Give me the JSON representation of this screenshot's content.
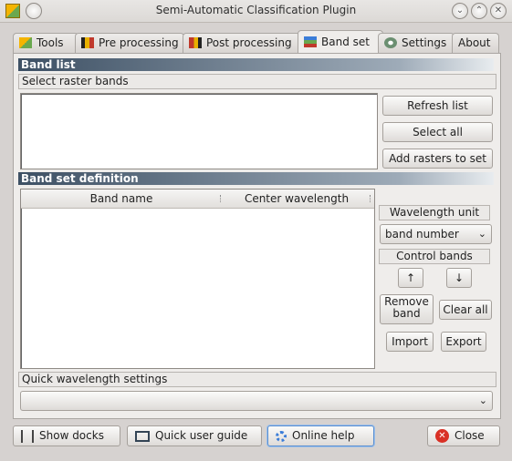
{
  "window": {
    "title": "Semi-Automatic Classification Plugin"
  },
  "tabs": [
    {
      "label": "Tools",
      "icon": "tools-icon"
    },
    {
      "label": "Pre processing",
      "icon": "pre-processing-icon"
    },
    {
      "label": "Post processing",
      "icon": "post-processing-icon"
    },
    {
      "label": "Band set",
      "icon": "band-set-icon",
      "active": true
    },
    {
      "label": "Settings",
      "icon": "settings-icon"
    },
    {
      "label": "About",
      "icon": ""
    }
  ],
  "band_list": {
    "header": "Band list",
    "subheader": "Select raster bands",
    "refresh_label": "Refresh list",
    "select_all_label": "Select all",
    "add_rasters_label": "Add rasters to set"
  },
  "band_set": {
    "header": "Band set definition",
    "columns": [
      "Band name",
      "Center wavelength"
    ],
    "wavelength_unit_label": "Wavelength unit",
    "wavelength_unit_value": "band number",
    "control_bands_label": "Control bands",
    "up_label": "↑",
    "down_label": "↓",
    "remove_band_label": "Remove band",
    "clear_all_label": "Clear all",
    "import_label": "Import",
    "export_label": "Export"
  },
  "quick_wavelength": {
    "label": "Quick wavelength settings",
    "value": ""
  },
  "bottom_bar": {
    "show_docks_label": "Show docks",
    "quick_guide_label": "Quick user guide",
    "online_help_label": "Online help",
    "close_label": "Close"
  },
  "colors": {
    "section_header": "#3d5064",
    "close_icon": "#d93025"
  }
}
